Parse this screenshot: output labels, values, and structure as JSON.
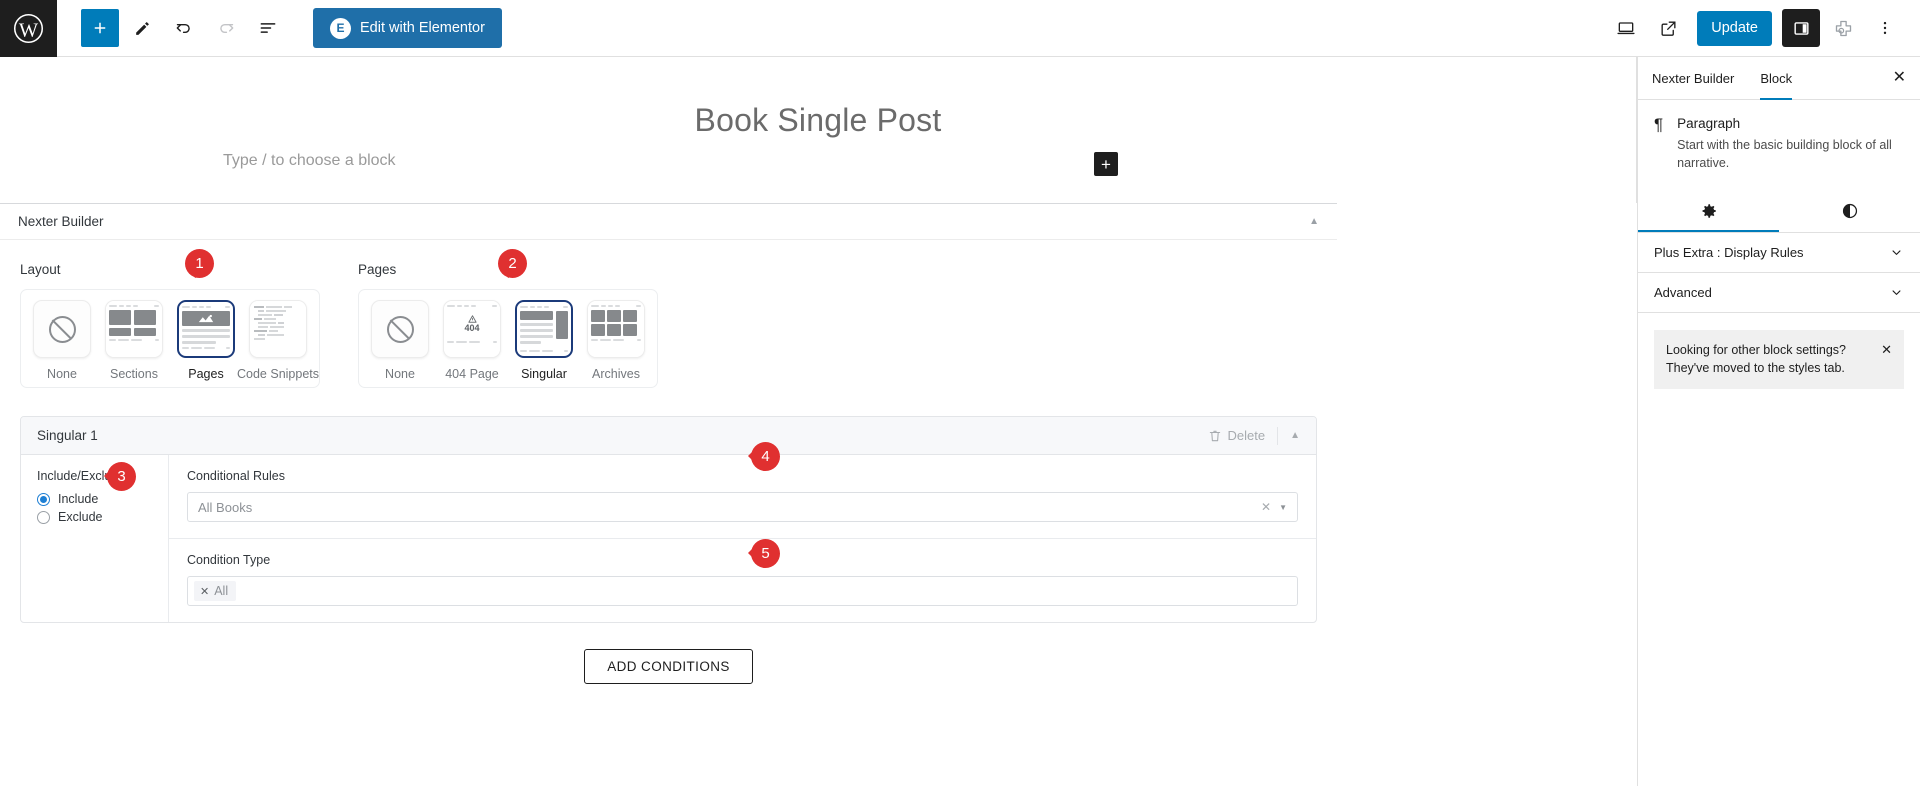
{
  "topbar": {
    "logo_icon": "wordpress-logo-icon",
    "tools": [
      {
        "name": "block-inserter-button",
        "icon": "plus-icon",
        "label": "+"
      },
      {
        "name": "tools-pencil-button",
        "icon": "pencil-icon",
        "label": ""
      },
      {
        "name": "undo-button",
        "icon": "undo-icon",
        "label": ""
      },
      {
        "name": "redo-button",
        "icon": "redo-icon",
        "label": ""
      },
      {
        "name": "document-overview-button",
        "icon": "list-view-icon",
        "label": ""
      }
    ],
    "elementor_label": "Edit with Elementor",
    "elementor_badge": "E",
    "view_icon": "desktop-preview-icon",
    "external_icon": "view-post-external-icon",
    "update_label": "Update",
    "settings_icon": "settings-sidebar-icon",
    "plugin_icon": "nexter-plugin-icon",
    "more_icon": "options-ellipsis-icon"
  },
  "canvas": {
    "post_title": "Book Single Post",
    "block_placeholder": "Type / to choose a block",
    "inserter_label": "+"
  },
  "nexter": {
    "panel_title": "Nexter Builder",
    "collapse_icon": "caret-up-icon",
    "layout": {
      "label": "Layout",
      "options": [
        {
          "label": "None",
          "icon": "no-entry-icon",
          "selected": false
        },
        {
          "label": "Sections",
          "icon": "sections-layout-icon",
          "selected": false
        },
        {
          "label": "Pages",
          "icon": "pages-layout-icon",
          "selected": true
        },
        {
          "label": "Code Snippets",
          "icon": "code-snippets-icon",
          "selected": false
        }
      ]
    },
    "pages": {
      "label": "Pages",
      "options": [
        {
          "label": "None",
          "icon": "no-entry-icon",
          "selected": false
        },
        {
          "label": "404 Page",
          "icon": "404-page-icon",
          "selected": false
        },
        {
          "label": "Singular",
          "icon": "singular-layout-icon",
          "selected": true
        },
        {
          "label": "Archives",
          "icon": "archives-grid-icon",
          "selected": false
        }
      ]
    },
    "singular_card": {
      "title": "Singular 1",
      "delete_label": "Delete",
      "delete_icon": "trash-icon",
      "collapse_icon": "caret-up-icon",
      "include_exclude_label": "Include/Exclude",
      "radios": [
        {
          "label": "Include",
          "selected": true
        },
        {
          "label": "Exclude",
          "selected": false
        }
      ],
      "conditional_rules_label": "Conditional Rules",
      "conditional_rules_value": "All Books",
      "conditional_clear_icon": "clear-x-icon",
      "conditional_caret_icon": "caret-down-icon",
      "condition_type_label": "Condition Type",
      "condition_type_tokens": [
        "All"
      ],
      "token_remove_icon": "remove-token-x-icon"
    },
    "add_conditions_label": "ADD CONDITIONS"
  },
  "sidebar": {
    "tabs": [
      {
        "label": "Nexter Builder",
        "active": false
      },
      {
        "label": "Block",
        "active": true
      }
    ],
    "close_icon": "close-icon",
    "close_label": "✕",
    "block": {
      "icon": "paragraph-pilcrow-icon",
      "icon_glyph": "¶",
      "title": "Paragraph",
      "description": "Start with the basic building block of all narrative."
    },
    "icon_tabs": [
      {
        "name": "settings-tab",
        "icon": "gear-icon",
        "active": true
      },
      {
        "name": "styles-tab",
        "icon": "contrast-half-circle-icon",
        "active": false
      }
    ],
    "rows": [
      {
        "label": "Plus Extra : Display Rules",
        "icon": "chevron-down-icon"
      },
      {
        "label": "Advanced",
        "icon": "chevron-down-icon"
      }
    ],
    "notice": {
      "text": "Looking for other block settings? They've moved to the styles tab.",
      "close_icon": "close-icon",
      "close_label": "✕"
    }
  },
  "badges": [
    {
      "number": "1"
    },
    {
      "number": "2"
    },
    {
      "number": "3"
    },
    {
      "number": "4"
    },
    {
      "number": "5"
    }
  ],
  "colors": {
    "accent": "#007cba",
    "elementor": "#1f6fa9",
    "badge": "#e03030",
    "selected_border": "#1b3a7a"
  }
}
